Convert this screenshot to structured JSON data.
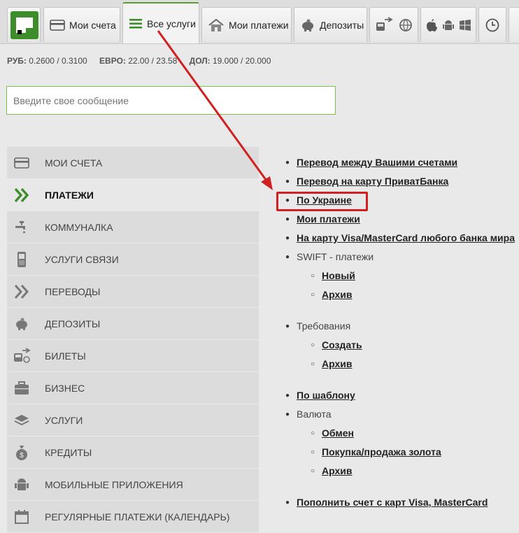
{
  "top_tabs": [
    {
      "label": "",
      "icon": "privatbank-logo"
    },
    {
      "label": "Мои счета",
      "icon": "card-icon"
    },
    {
      "label": "Все услуги",
      "icon": "list-icon",
      "active": true
    },
    {
      "label": "Мои платежи",
      "icon": "home-icon"
    },
    {
      "label": "Депозиты",
      "icon": "piggy-bank-icon"
    },
    {
      "label": "",
      "icon": "transport-icon"
    },
    {
      "label": "",
      "icon": "globe-icon"
    },
    {
      "label": "",
      "icon": "apple-icon"
    },
    {
      "label": "",
      "icon": "android-icon"
    },
    {
      "label": "",
      "icon": "windows-icon"
    },
    {
      "label": "",
      "icon": "clock-icon"
    }
  ],
  "rates": {
    "rub_label": "РУБ:",
    "rub_value": "0.2600 / 0.3100",
    "eur_label": "ЕВРО:",
    "eur_value": "22.00 / 23.58",
    "usd_label": "ДОЛ:",
    "usd_value": "19.000 / 20.000"
  },
  "message": {
    "placeholder": "Введите свое сообщение"
  },
  "menu": [
    {
      "label": "МОИ СЧЕТА",
      "icon": "card-icon"
    },
    {
      "label": "ПЛАТЕЖИ",
      "icon": "double-chevron-icon",
      "selected": true
    },
    {
      "label": "КОММУНАЛКА",
      "icon": "faucet-icon"
    },
    {
      "label": "УСЛУГИ СВЯЗИ",
      "icon": "phone-icon"
    },
    {
      "label": "ПЕРЕВОДЫ",
      "icon": "double-chevron-icon"
    },
    {
      "label": "ДЕПОЗИТЫ",
      "icon": "piggy-bank-icon"
    },
    {
      "label": "БИЛЕТЫ",
      "icon": "ticket-icon"
    },
    {
      "label": "БИЗНЕС",
      "icon": "briefcase-icon"
    },
    {
      "label": "УСЛУГИ",
      "icon": "layers-icon"
    },
    {
      "label": "КРЕДИТЫ",
      "icon": "money-bag-icon"
    },
    {
      "label": "МОБИЛЬНЫЕ ПРИЛОЖЕНИЯ",
      "icon": "apps-icon"
    },
    {
      "label": "РЕГУЛЯРНЫЕ ПЛАТЕЖИ (КАЛЕНДАРЬ)",
      "icon": "calendar-icon"
    }
  ],
  "links": {
    "transfer_between": "Перевод между Вашими счетами",
    "transfer_privat": "Перевод на карту ПриватБанка",
    "ukraine": "По Украине",
    "my_payments": "Мои платежи",
    "visa_mc": "На карту Visa/MasterCard любого банка мира",
    "swift": "SWIFT - платежи",
    "swift_new": "Новый",
    "swift_archive": "Архив",
    "requirements": "Требования",
    "req_create": "Создать",
    "req_archive": "Архив",
    "by_template": "По шаблону",
    "currency": "Валюта",
    "cur_exchange": "Обмен",
    "cur_gold": "Покупка/продажа золота",
    "cur_archive": "Архив",
    "topup": "Пополнить счет с карт Visa, MasterCard"
  },
  "colors": {
    "accent": "#5a9e2f",
    "highlight": "#d12020"
  }
}
